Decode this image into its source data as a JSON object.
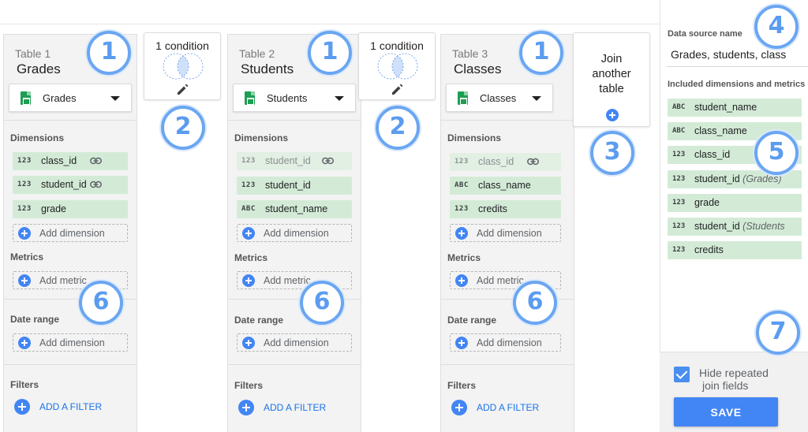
{
  "tables": [
    {
      "number": "Table 1",
      "name": "Grades",
      "source": "Grades",
      "dimensions_label": "Dimensions",
      "dimensions": [
        {
          "type": "123",
          "name": "class_id",
          "join_key": true,
          "disabled": false
        },
        {
          "type": "123",
          "name": "student_id",
          "join_key": true,
          "disabled": false
        },
        {
          "type": "123",
          "name": "grade",
          "join_key": false,
          "disabled": false
        }
      ],
      "add_dimension": "Add dimension",
      "metrics_label": "Metrics",
      "add_metric": "Add metric",
      "date_range_label": "Date range",
      "date_add_dimension": "Add dimension",
      "filters_label": "Filters",
      "add_filter": "ADD A FILTER"
    },
    {
      "number": "Table 2",
      "name": "Students",
      "source": "Students",
      "dimensions_label": "Dimensions",
      "dimensions": [
        {
          "type": "123",
          "name": "student_id",
          "join_key": true,
          "disabled": true
        },
        {
          "type": "123",
          "name": "student_id",
          "join_key": false,
          "disabled": false
        },
        {
          "type": "ABC",
          "name": "student_name",
          "join_key": false,
          "disabled": false
        }
      ],
      "add_dimension": "Add dimension",
      "metrics_label": "Metrics",
      "add_metric": "Add metric",
      "date_range_label": "Date range",
      "date_add_dimension": "Add dimension",
      "filters_label": "Filters",
      "add_filter": "ADD A FILTER"
    },
    {
      "number": "Table 3",
      "name": "Classes",
      "source": "Classes",
      "dimensions_label": "Dimensions",
      "dimensions": [
        {
          "type": "123",
          "name": "class_id",
          "join_key": true,
          "disabled": true
        },
        {
          "type": "ABC",
          "name": "class_name",
          "join_key": false,
          "disabled": false
        },
        {
          "type": "123",
          "name": "credits",
          "join_key": false,
          "disabled": false
        }
      ],
      "add_dimension": "Add dimension",
      "metrics_label": "Metrics",
      "add_metric": "Add metric",
      "date_range_label": "Date range",
      "date_add_dimension": "Add dimension",
      "filters_label": "Filters",
      "add_filter": "ADD A FILTER"
    }
  ],
  "conditions": [
    {
      "label": "1 condition"
    },
    {
      "label": "1 condition"
    }
  ],
  "join_card": {
    "line1": "Join",
    "line2": "another",
    "line3": "table"
  },
  "data_source": {
    "label": "Data source name",
    "value": "Grades, students, class",
    "included_label": "Included dimensions and metrics",
    "fields": [
      {
        "type": "ABC",
        "name": "student_name",
        "source": ""
      },
      {
        "type": "ABC",
        "name": "class_name",
        "source": ""
      },
      {
        "type": "123",
        "name": "class_id",
        "source": ""
      },
      {
        "type": "123",
        "name": "student_id",
        "source": "(Grades)"
      },
      {
        "type": "123",
        "name": "grade",
        "source": ""
      },
      {
        "type": "123",
        "name": "student_id",
        "source": "(Students"
      },
      {
        "type": "123",
        "name": "credits",
        "source": ""
      }
    ]
  },
  "footer": {
    "hide_repeated_line1": "Hide repeated",
    "hide_repeated_line2": "join fields",
    "hide_repeated_checked": true,
    "save_label": "SAVE"
  },
  "callouts": {
    "one": "1",
    "two": "2",
    "three": "3",
    "four": "4",
    "five": "5",
    "six": "6",
    "seven": "7"
  },
  "colors": {
    "accent_blue": "#4285f4",
    "field_green": "#d3ebd6",
    "callout_blue": "#5b9cf0"
  }
}
